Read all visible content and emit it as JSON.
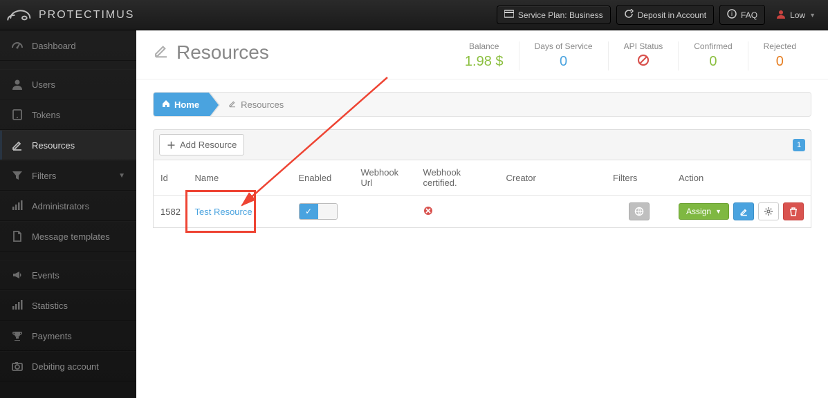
{
  "brand": "PROTECTIMUS",
  "topbar": {
    "service_plan": "Service Plan: Business",
    "deposit": "Deposit in Account",
    "faq": "FAQ",
    "user": "Low"
  },
  "sidebar": {
    "dashboard": "Dashboard",
    "users": "Users",
    "tokens": "Tokens",
    "resources": "Resources",
    "filters": "Filters",
    "administrators": "Administrators",
    "message_templates": "Message templates",
    "events": "Events",
    "statistics": "Statistics",
    "payments": "Payments",
    "debiting": "Debiting account"
  },
  "page": {
    "title": "Resources"
  },
  "metrics": {
    "balance_label": "Balance",
    "balance_value": "1.98 $",
    "days_label": "Days of Service",
    "days_value": "0",
    "api_label": "API Status",
    "confirmed_label": "Confirmed",
    "confirmed_value": "0",
    "rejected_label": "Rejected",
    "rejected_value": "0"
  },
  "breadcrumb": {
    "home": "Home",
    "resources": "Resources"
  },
  "toolbar": {
    "add": "Add Resource",
    "page_badge": "1"
  },
  "table": {
    "headers": {
      "id": "Id",
      "name": "Name",
      "enabled": "Enabled",
      "webhook_url": "Webhook Url",
      "webhook_cert": "Webhook certified.",
      "creator": "Creator",
      "filters": "Filters",
      "action": "Action"
    },
    "rows": [
      {
        "id": "1582",
        "name": "Test Resource",
        "enabled": true,
        "webhook_url": "",
        "webhook_certified": false,
        "creator": "",
        "assign_label": "Assign"
      }
    ]
  }
}
